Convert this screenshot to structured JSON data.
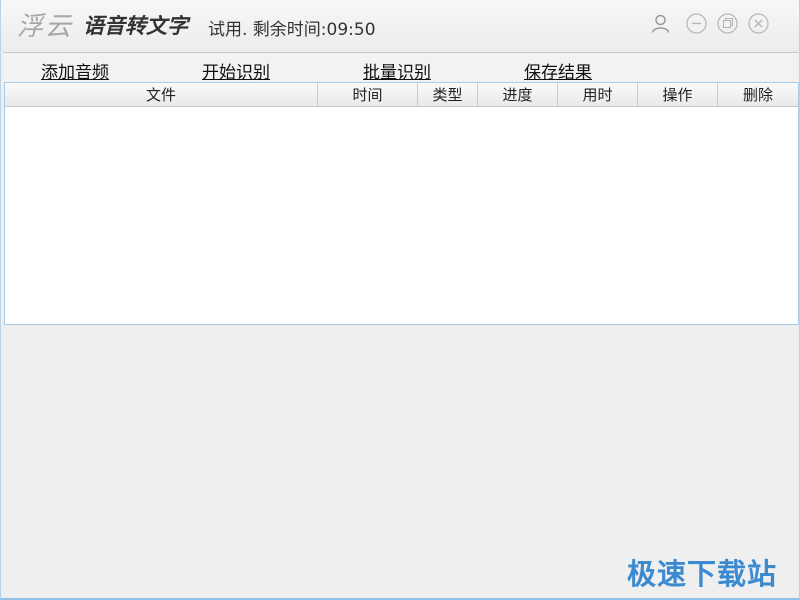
{
  "titlebar": {
    "brand": "浮云",
    "app_name": "语音转文字",
    "trial_status": "试用. 剩余时间:09:50",
    "icons": [
      "user-icon",
      "minimize-icon",
      "maximize-icon",
      "close-icon"
    ]
  },
  "toolbar": {
    "add_audio": "添加音频",
    "start_recognition": "开始识别",
    "batch_recognition": "批量识别",
    "save_results": "保存结果"
  },
  "table": {
    "columns": [
      "文件",
      "时间",
      "类型",
      "进度",
      "用时",
      "操作",
      "删除"
    ],
    "rows": []
  },
  "watermark": "极速下载站",
  "colors": {
    "accent": "#3b8ad0",
    "border": "#a9cbe8",
    "background": "#efefef"
  }
}
